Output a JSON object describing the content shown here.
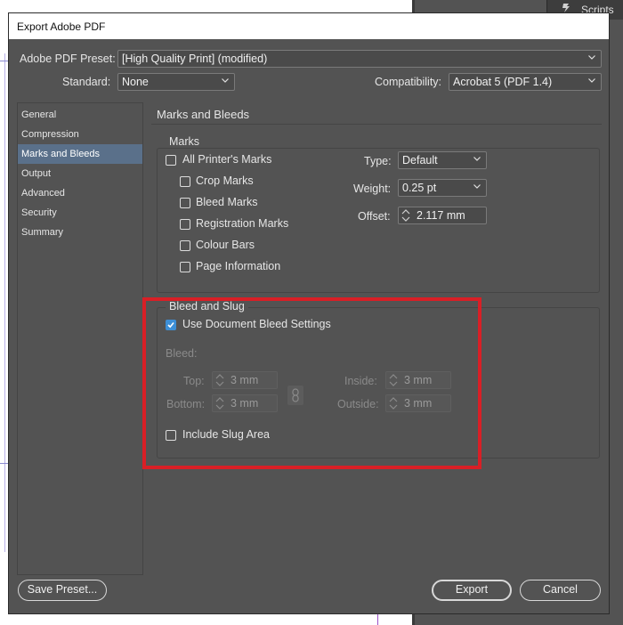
{
  "background": {
    "panel_label": "Scripts",
    "panel_icon": "scripts-icon"
  },
  "dialog": {
    "title": "Export Adobe PDF",
    "preset_label": "Adobe PDF Preset:",
    "preset_value": "[High Quality Print] (modified)",
    "standard_label": "Standard:",
    "standard_value": "None",
    "compatibility_label": "Compatibility:",
    "compatibility_value": "Acrobat 5 (PDF 1.4)"
  },
  "sidebar": {
    "items": [
      {
        "label": "General",
        "active": false
      },
      {
        "label": "Compression",
        "active": false
      },
      {
        "label": "Marks and Bleeds",
        "active": true
      },
      {
        "label": "Output",
        "active": false
      },
      {
        "label": "Advanced",
        "active": false
      },
      {
        "label": "Security",
        "active": false
      },
      {
        "label": "Summary",
        "active": false
      }
    ]
  },
  "panel": {
    "title": "Marks and Bleeds"
  },
  "marks": {
    "title": "Marks",
    "all_printers_marks": {
      "label": "All Printer's Marks",
      "checked": false
    },
    "items": [
      {
        "label": "Crop Marks",
        "checked": false
      },
      {
        "label": "Bleed Marks",
        "checked": false
      },
      {
        "label": "Registration Marks",
        "checked": false
      },
      {
        "label": "Colour Bars",
        "checked": false
      },
      {
        "label": "Page Information",
        "checked": false
      }
    ],
    "type_label": "Type:",
    "type_value": "Default",
    "weight_label": "Weight:",
    "weight_value": "0.25 pt",
    "offset_label": "Offset:",
    "offset_value": "2.117 mm"
  },
  "bleed_slug": {
    "title": "Bleed and Slug",
    "use_document_bleed": {
      "label": "Use Document Bleed Settings",
      "checked": true
    },
    "bleed_label": "Bleed:",
    "top_label": "Top:",
    "top_value": "3 mm",
    "bottom_label": "Bottom:",
    "bottom_value": "3 mm",
    "inside_label": "Inside:",
    "inside_value": "3 mm",
    "outside_label": "Outside:",
    "outside_value": "3 mm",
    "include_slug": {
      "label": "Include Slug Area",
      "checked": false
    },
    "highlight_color": "#d91f26"
  },
  "footer": {
    "save_preset_label": "Save Preset...",
    "export_label": "Export",
    "cancel_label": "Cancel"
  },
  "colors": {
    "dialog_bg": "#535353",
    "sidebar_active": "#5a708a",
    "checkbox_accent": "#3d8fd6"
  }
}
